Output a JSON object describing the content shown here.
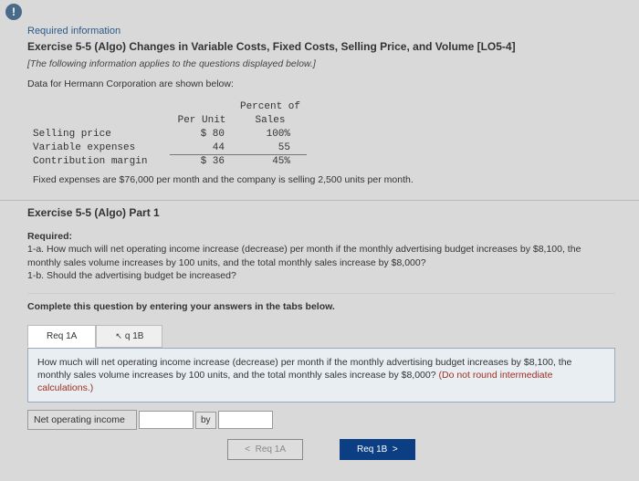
{
  "alert": "!",
  "reqInfoLabel": "Required information",
  "exerciseTitle": "Exercise 5-5 (Algo) Changes in Variable Costs, Fixed Costs, Selling Price, and Volume [LO5-4]",
  "italicNote": "[The following information applies to the questions displayed below.]",
  "introLine": "Data for Hermann Corporation are shown below:",
  "table": {
    "h1": "Per Unit",
    "h2a": "Percent of",
    "h2b": "Sales",
    "rows": [
      {
        "label": "Selling price",
        "perUnit": "$ 80",
        "pct": "100%"
      },
      {
        "label": "Variable expenses",
        "perUnit": "44",
        "pct": "55"
      },
      {
        "label": "Contribution margin",
        "perUnit": "$ 36",
        "pct": "45%"
      }
    ]
  },
  "fixedLine": "Fixed expenses are $76,000 per month and the company is selling 2,500 units per month.",
  "partTitle": "Exercise 5-5 (Algo) Part 1",
  "requiredLabel": "Required:",
  "requiredText1": "1-a. How much will net operating income increase (decrease) per month if the monthly advertising budget increases by $8,100, the monthly sales volume increases by 100 units, and the total monthly sales increase by $8,000?",
  "requiredText2": "1-b. Should the advertising budget be increased?",
  "instruction": "Complete this question by entering your answers in the tabs below.",
  "tabs": {
    "a": "Req 1A",
    "b": "q 1B"
  },
  "questionText": "How much will net operating income increase (decrease) per month if the monthly advertising budget increases by $8,100, the monthly sales volume increases by 100 units, and the total monthly sales increase by $8,000? ",
  "questionWarn": "(Do not round intermediate calculations.)",
  "answerLabel": "Net operating income",
  "byLabel": "by",
  "navPrev": "Req 1A",
  "navNext": "Req 1B",
  "chevronLeft": "<",
  "chevronRight": ">"
}
